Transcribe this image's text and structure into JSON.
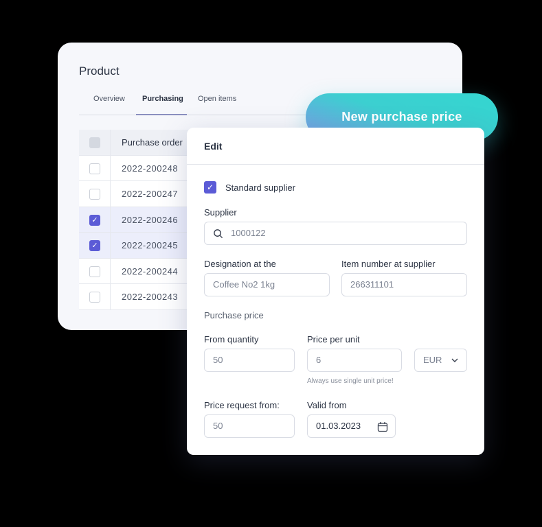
{
  "product": {
    "title": "Product",
    "tabs": [
      {
        "label": "Overview"
      },
      {
        "label": "Purchasing",
        "active": true
      },
      {
        "label": "Open items"
      }
    ],
    "table": {
      "header": "Purchase order",
      "rows": [
        {
          "order": "2022-200248",
          "checked": false
        },
        {
          "order": "2022-200247",
          "checked": false
        },
        {
          "order": "2022-200246",
          "checked": true
        },
        {
          "order": "2022-200245",
          "checked": true
        },
        {
          "order": "2022-200244",
          "checked": false
        },
        {
          "order": "2022-200243",
          "checked": false
        }
      ]
    }
  },
  "badge": {
    "label": "New purchase price"
  },
  "edit": {
    "title": "Edit",
    "standard_supplier": {
      "label": "Standard supplier",
      "checked": true
    },
    "supplier": {
      "label": "Supplier",
      "value": "1000122"
    },
    "designation": {
      "label": "Designation at the",
      "value": "Coffee No2 1kg"
    },
    "item_number": {
      "label": "Item number at supplier",
      "value": "266311101"
    },
    "purchase_price_heading": "Purchase price",
    "from_quantity": {
      "label": "From quantity",
      "value": "50"
    },
    "price_per_unit": {
      "label": "Price per unit",
      "value": "6",
      "hint": "Always use single unit price!"
    },
    "currency": {
      "value": "EUR"
    },
    "price_request": {
      "label": "Price request from:",
      "value": "50"
    },
    "valid_from": {
      "label": "Valid from",
      "value": "01.03.2023"
    }
  },
  "colors": {
    "accent": "#5b5bd6",
    "badge_start": "#34d6d0",
    "badge_end": "#7d9ae6"
  }
}
